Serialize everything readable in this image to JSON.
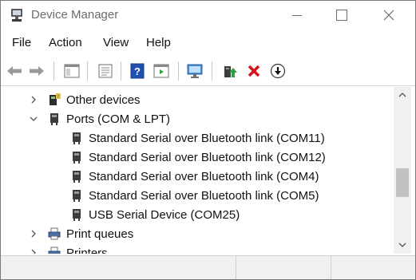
{
  "window": {
    "title": "Device Manager"
  },
  "menu": {
    "file": "File",
    "action": "Action",
    "view": "View",
    "help": "Help"
  },
  "toolbar": {
    "icons": [
      "back-arrow-icon",
      "forward-arrow-icon",
      "show-hide-console-tree-icon",
      "properties-icon",
      "help-icon",
      "details-pane-icon",
      "scan-hardware-icon",
      "update-driver-icon",
      "uninstall-device-icon",
      "disable-device-icon"
    ]
  },
  "tree": {
    "other_devices": "Other devices",
    "ports": "Ports (COM & LPT)",
    "ports_children": [
      "Standard Serial over Bluetooth link (COM11)",
      "Standard Serial over Bluetooth link (COM12)",
      "Standard Serial over Bluetooth link (COM4)",
      "Standard Serial over Bluetooth link (COM5)",
      "USB Serial Device (COM25)"
    ],
    "print_queues": "Print queues",
    "printers": "Printers"
  },
  "colors": {
    "accent_blue": "#1f5fbf",
    "delete_red": "#d4141b",
    "green_arrow": "#2f9e3f"
  }
}
